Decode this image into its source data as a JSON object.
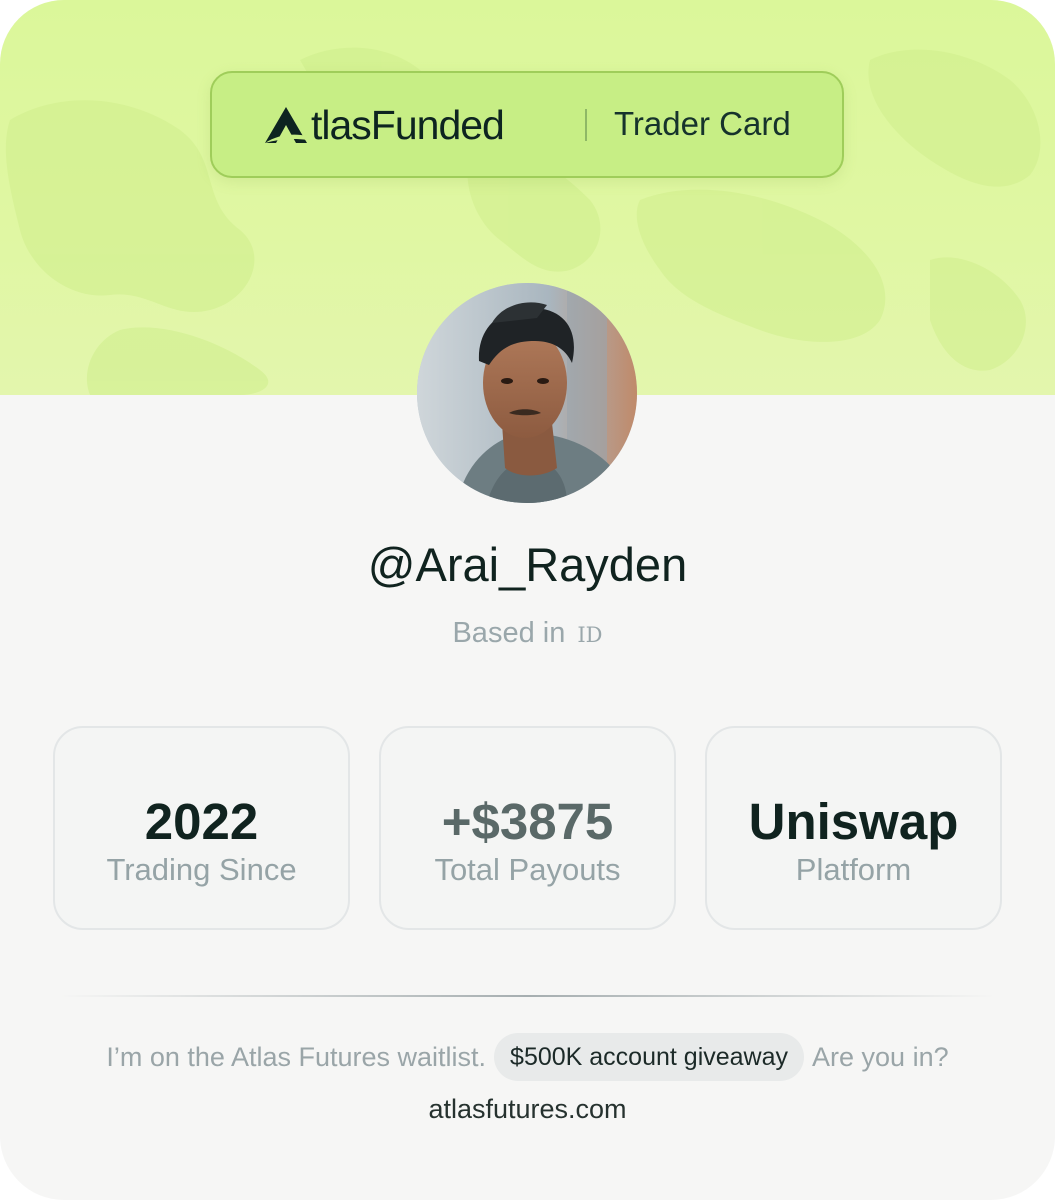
{
  "brand": {
    "wordmark": "tlasFunded",
    "tag": "Trader Card"
  },
  "profile": {
    "handle": "@Arai_Rayden",
    "location_prefix": "Based in",
    "location_code": "ID"
  },
  "stats": [
    {
      "value": "2022",
      "label": "Trading Since"
    },
    {
      "value": "+$3875",
      "label": "Total Payouts"
    },
    {
      "value": "Uniswap",
      "label": "Platform"
    }
  ],
  "promo": {
    "before": "I’m on the Atlas Futures waitlist.",
    "badge": "$500K account giveaway",
    "after": "Are you in?"
  },
  "site": "atlasfutures.com",
  "colors": {
    "hero": "#dbf79a",
    "pill": "#c7ee85",
    "text": "#10231f"
  }
}
